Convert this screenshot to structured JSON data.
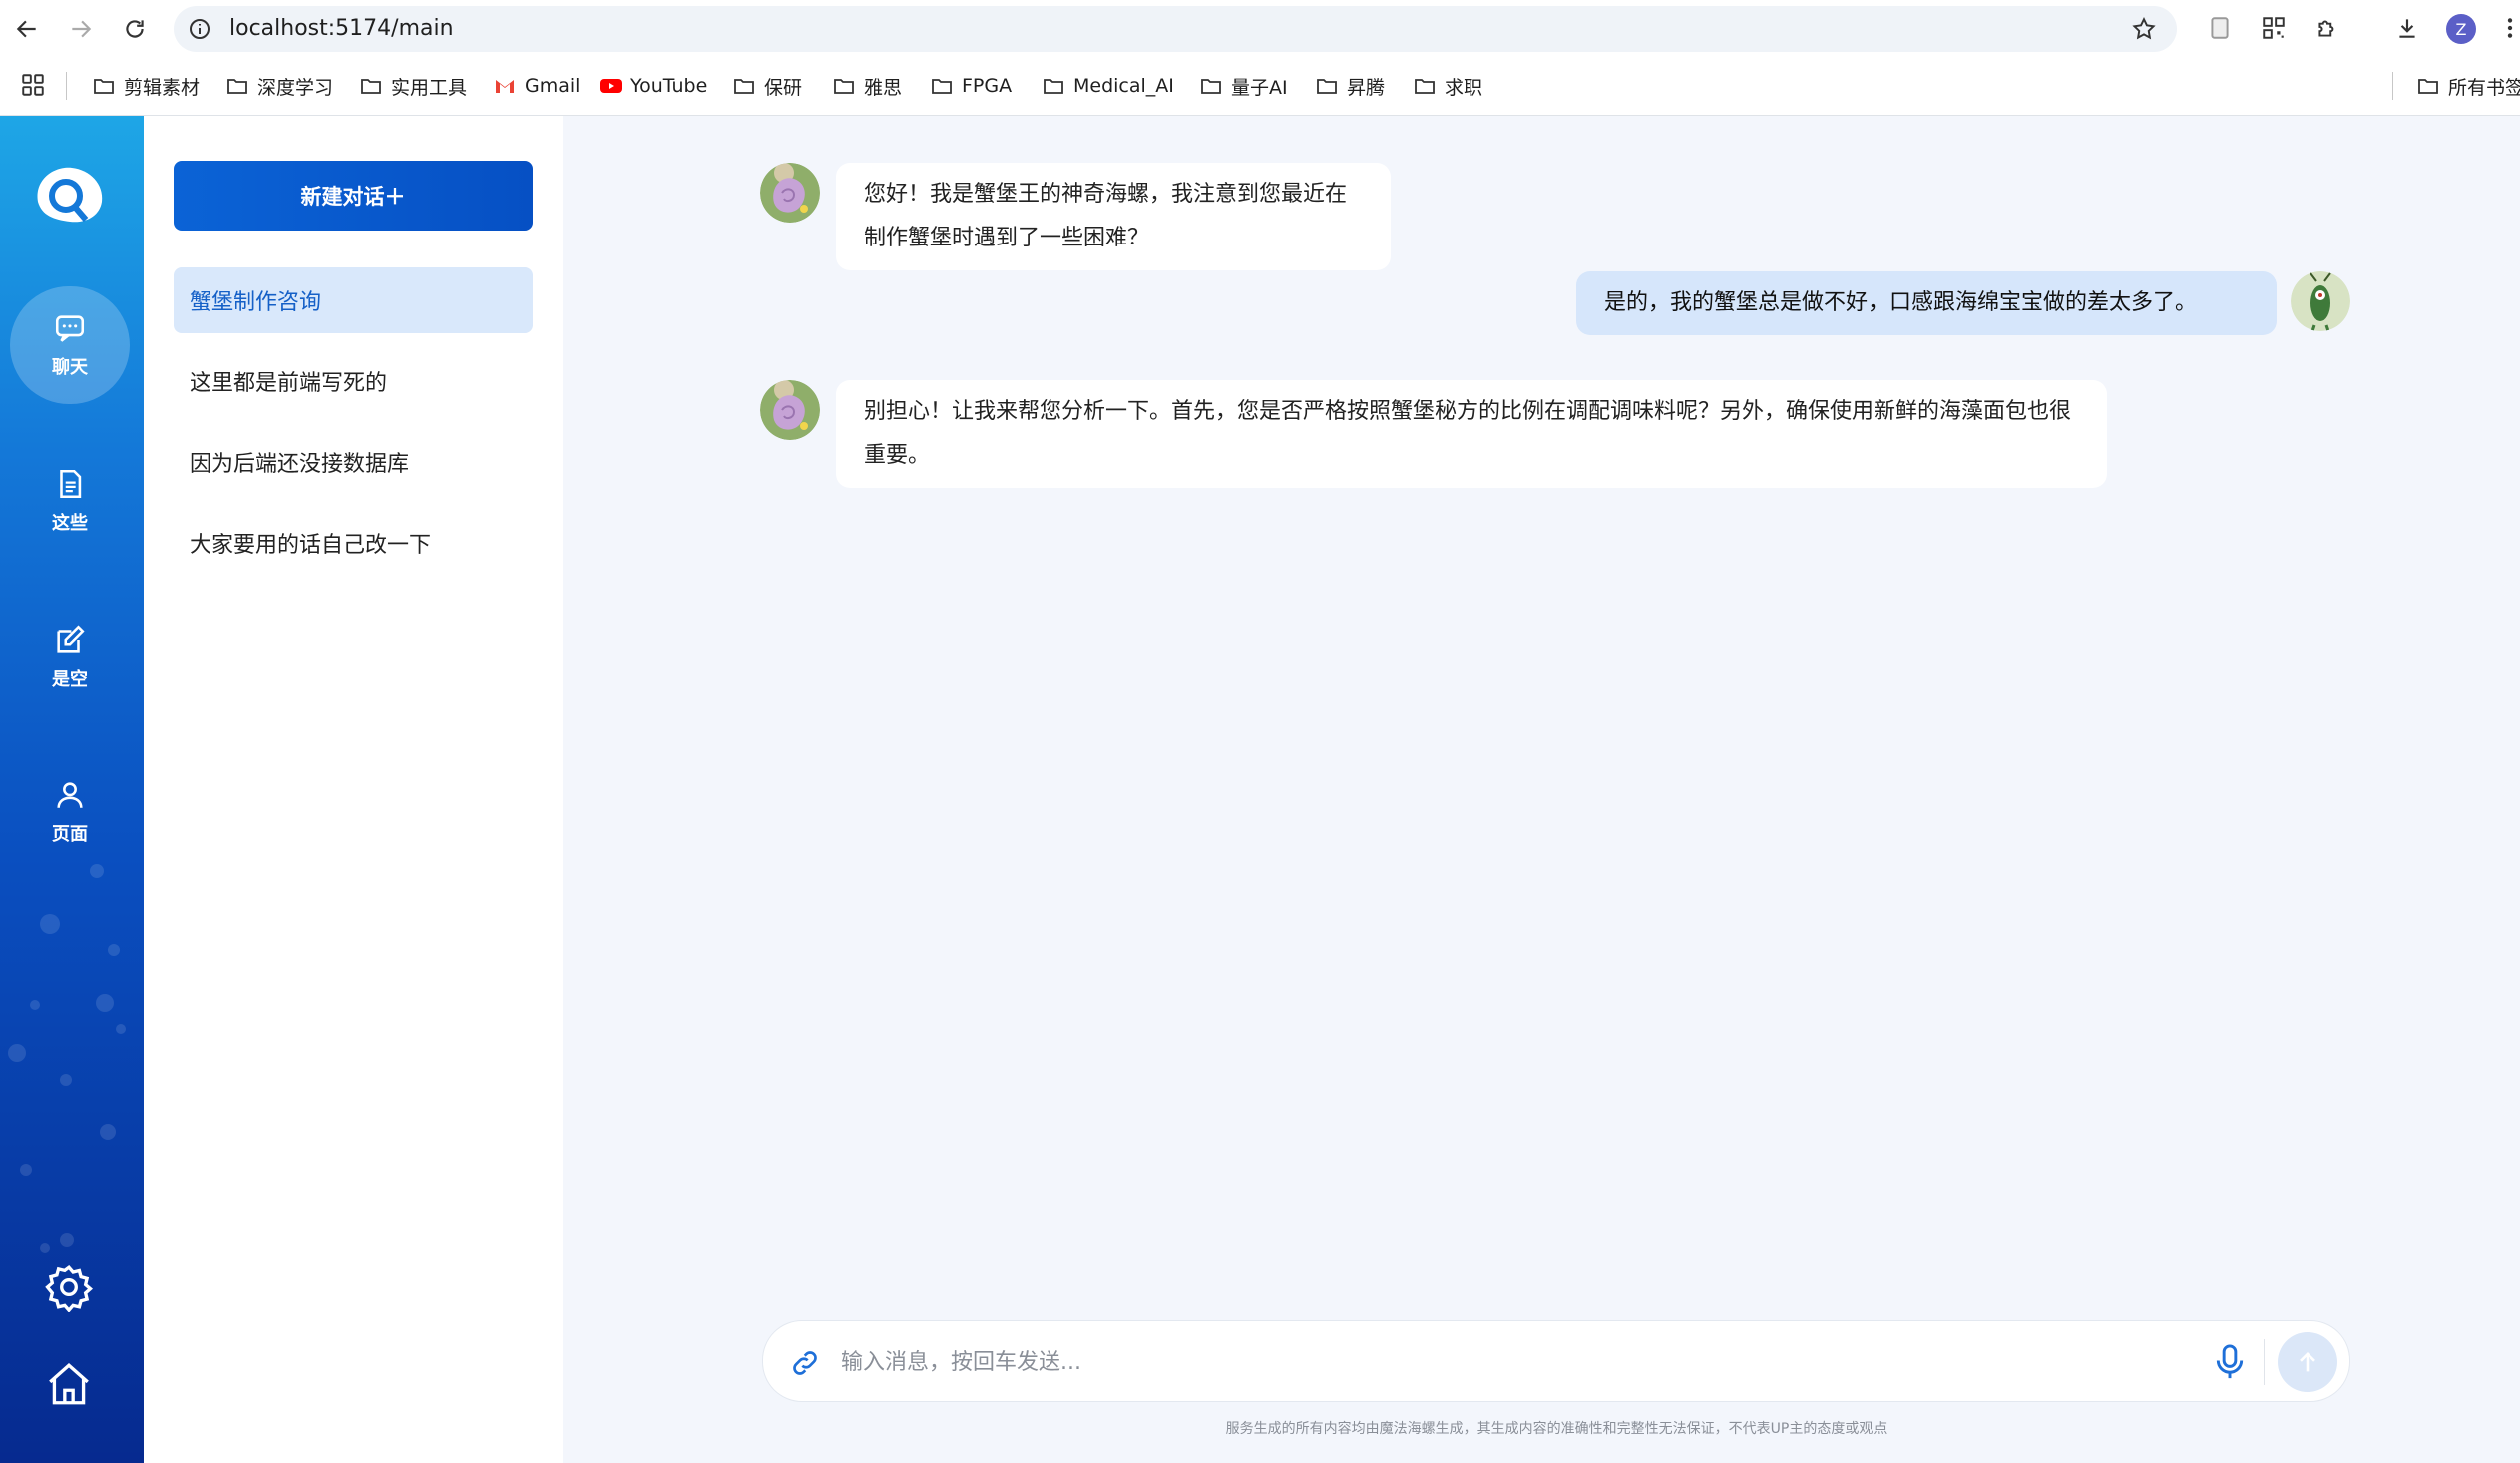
{
  "browser": {
    "url": "localhost:5174/main",
    "profile_initial": "Z",
    "bookmarks": [
      {
        "label": "剪辑素材",
        "icon": "folder-icon"
      },
      {
        "label": "深度学习",
        "icon": "folder-icon"
      },
      {
        "label": "实用工具",
        "icon": "folder-icon"
      },
      {
        "label": "Gmail",
        "icon": "gmail-icon"
      },
      {
        "label": "YouTube",
        "icon": "youtube-icon"
      },
      {
        "label": "保研",
        "icon": "folder-icon"
      },
      {
        "label": "雅思",
        "icon": "folder-icon"
      },
      {
        "label": "FPGA",
        "icon": "folder-icon"
      },
      {
        "label": "Medical_AI",
        "icon": "folder-icon"
      },
      {
        "label": "量子AI",
        "icon": "folder-icon"
      },
      {
        "label": "昇腾",
        "icon": "folder-icon"
      },
      {
        "label": "求职",
        "icon": "folder-icon"
      }
    ],
    "all_bookmarks_label": "所有书签"
  },
  "rail": {
    "items": [
      {
        "label": "聊天",
        "icon": "chat-icon",
        "active": true
      },
      {
        "label": "这些",
        "icon": "document-icon",
        "active": false
      },
      {
        "label": "是空",
        "icon": "edit-icon",
        "active": false
      },
      {
        "label": "页面",
        "icon": "user-icon",
        "active": false
      }
    ],
    "bottom": [
      "settings-icon",
      "home-icon"
    ]
  },
  "sidebar": {
    "new_chat_label": "新建对话＋",
    "conversations": [
      {
        "label": "蟹堡制作咨询",
        "active": true
      },
      {
        "label": "这里都是前端写死的",
        "active": false
      },
      {
        "label": "因为后端还没接数据库",
        "active": false
      },
      {
        "label": "大家要用的话自己改一下",
        "active": false
      }
    ]
  },
  "chat": {
    "messages": [
      {
        "role": "bot",
        "text": "您好！我是蟹堡王的神奇海螺，我注意到您最近在制作蟹堡时遇到了一些困难？"
      },
      {
        "role": "user",
        "text": "是的，我的蟹堡总是做不好，口感跟海绵宝宝做的差太多了。"
      },
      {
        "role": "bot",
        "text": "别担心！让我来帮您分析一下。首先，您是否严格按照蟹堡秘方的比例在调配调味料呢？另外，确保使用新鲜的海藻面包也很重要。"
      }
    ],
    "input_placeholder": "输入消息，按回车发送...",
    "disclaimer": "服务生成的所有内容均由魔法海螺生成，其生成内容的准确性和完整性无法保证，不代表UP主的态度或观点"
  },
  "colors": {
    "brand": "#0b63d6",
    "active_conversation_bg": "#d9e8fb",
    "user_bubble": "#d6e6fb"
  }
}
